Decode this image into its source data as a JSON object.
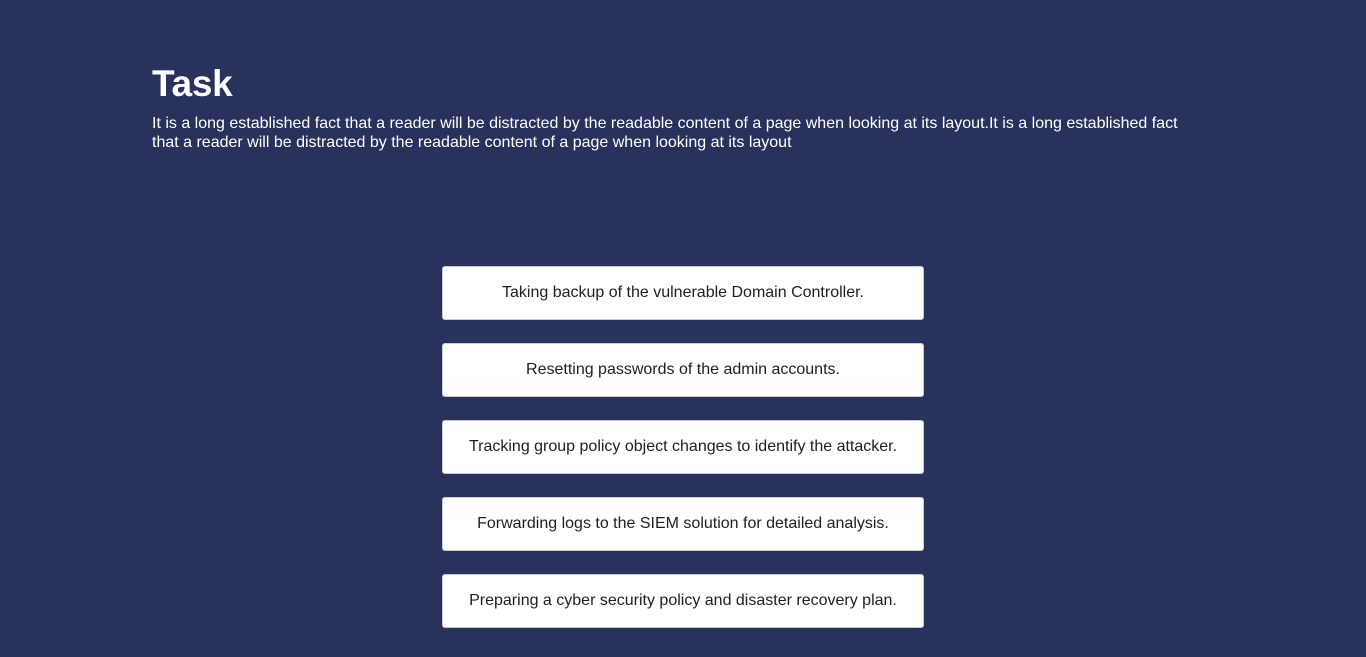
{
  "task": {
    "title": "Task",
    "description": "It is a long established fact that a reader will be distracted by the readable content of a page when looking at its layout.It is a long established fact that a reader will be distracted by the readable content of a page when looking at its layout"
  },
  "options": [
    {
      "label": "Taking backup of the vulnerable Domain Controller."
    },
    {
      "label": "Resetting passwords of the admin accounts."
    },
    {
      "label": "Tracking group policy object changes to identify the attacker."
    },
    {
      "label": "Forwarding logs to the SIEM solution for detailed analysis."
    },
    {
      "label": "Preparing a cyber security policy and disaster recovery plan."
    }
  ],
  "colors": {
    "background": "#28325c",
    "card": "#ffffff",
    "text_light": "#ffffff",
    "text_dark": "#1e1e1e"
  }
}
